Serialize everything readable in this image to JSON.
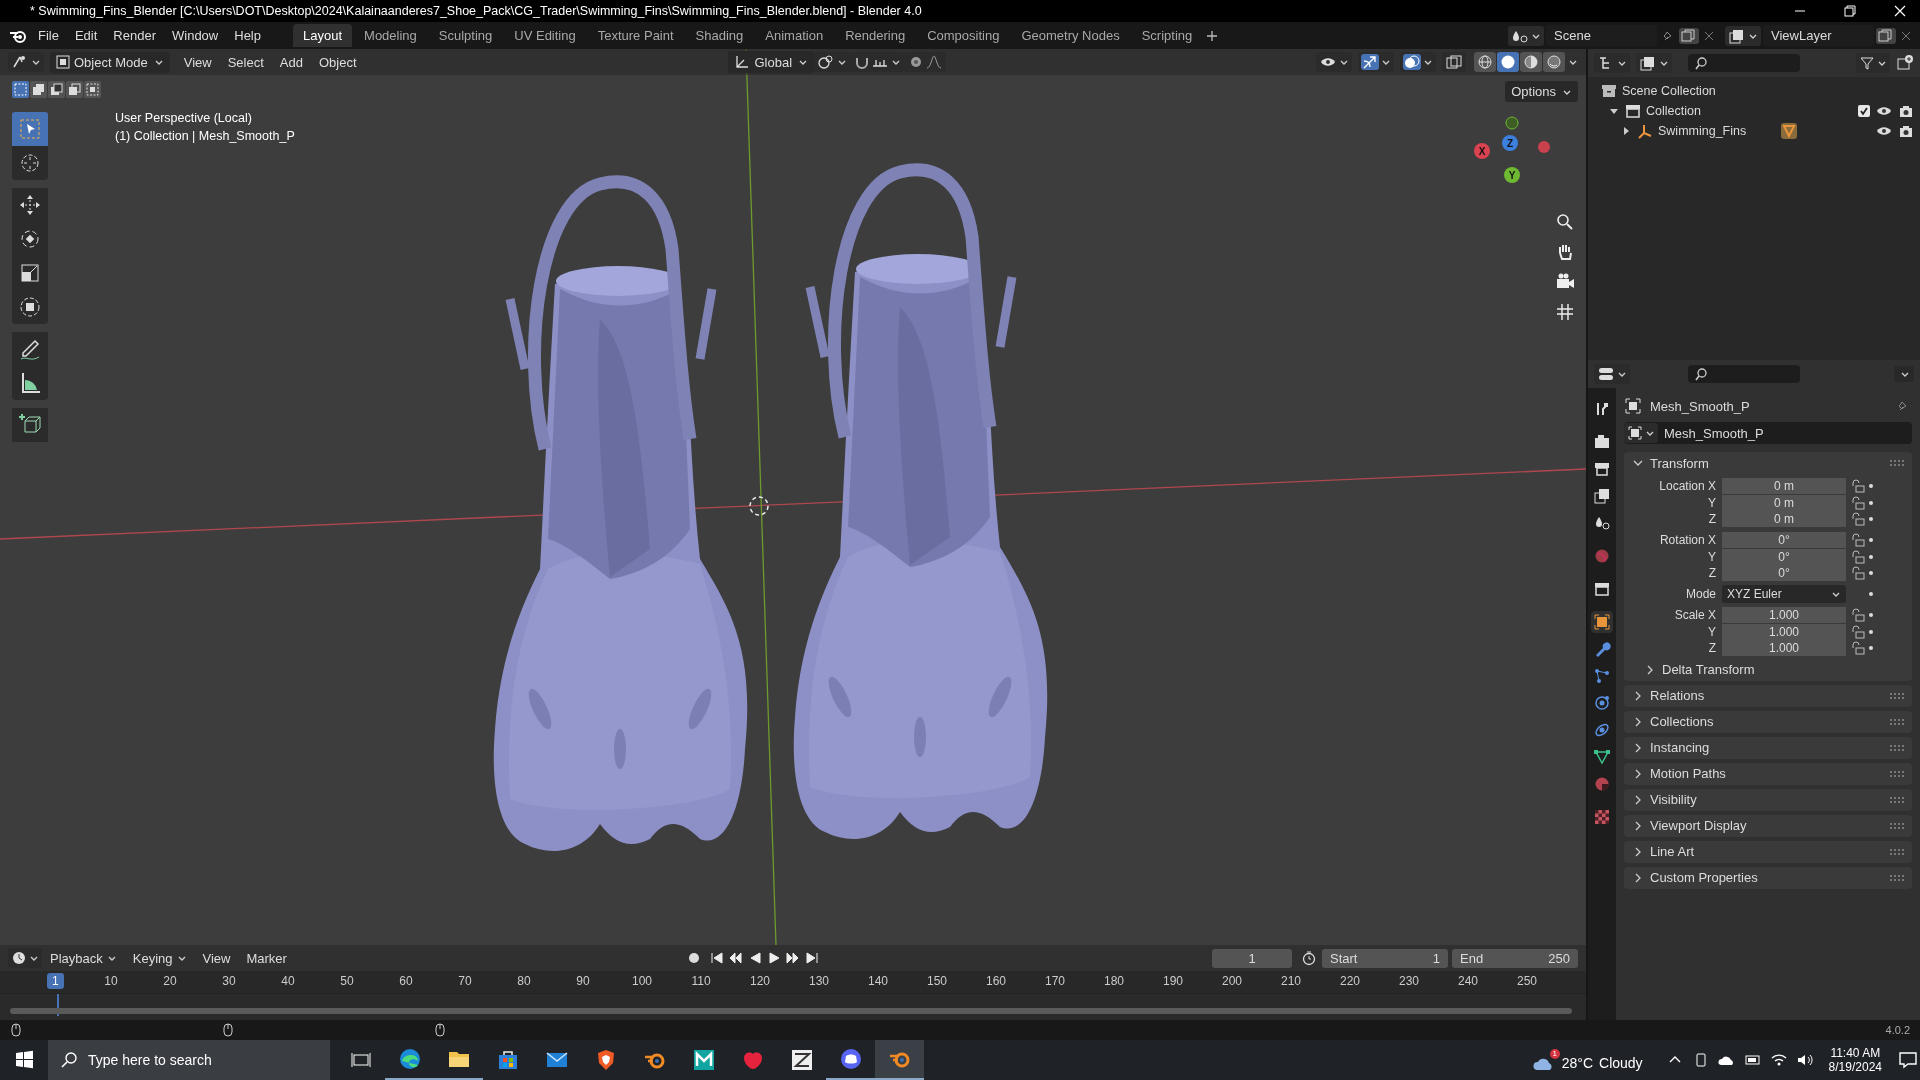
{
  "window": {
    "title": "* Swimming_Fins_Blender [C:\\Users\\DOT\\Desktop\\2024\\Kalainaanderes7_Shoe_Pack\\CG_Trader\\Swimming_Fins\\Swimming_Fins_Blender.blend] - Blender 4.0"
  },
  "menu": [
    "File",
    "Edit",
    "Render",
    "Window",
    "Help"
  ],
  "workspaces": [
    {
      "label": "Layout",
      "selected": true
    },
    {
      "label": "Modeling",
      "selected": false
    },
    {
      "label": "Sculpting",
      "selected": false
    },
    {
      "label": "UV Editing",
      "selected": false
    },
    {
      "label": "Texture Paint",
      "selected": false
    },
    {
      "label": "Shading",
      "selected": false
    },
    {
      "label": "Animation",
      "selected": false
    },
    {
      "label": "Rendering",
      "selected": false
    },
    {
      "label": "Compositing",
      "selected": false
    },
    {
      "label": "Geometry Nodes",
      "selected": false
    },
    {
      "label": "Scripting",
      "selected": false
    }
  ],
  "scene": {
    "value": "Scene"
  },
  "view_layer": {
    "value": "ViewLayer"
  },
  "viewport_header": {
    "mode": "Object Mode",
    "menus": [
      "View",
      "Select",
      "Add",
      "Object"
    ],
    "orientation": "Global",
    "toggles": [
      {
        "kind": "visibility",
        "on": false
      },
      {
        "kind": "gizmo",
        "on": true
      },
      {
        "kind": "overlay",
        "on": true
      },
      {
        "kind": "xray",
        "on": false
      }
    ],
    "shading": [
      {
        "kind": "wireframe",
        "selected": false
      },
      {
        "kind": "solid",
        "selected": true
      },
      {
        "kind": "material",
        "selected": false
      },
      {
        "kind": "rendered",
        "selected": false
      }
    ],
    "options": "Options"
  },
  "select_modes": [
    {
      "kind": "set",
      "selected": true
    },
    {
      "kind": "extend",
      "selected": false
    },
    {
      "kind": "subtract",
      "selected": false
    },
    {
      "kind": "difference",
      "selected": false
    },
    {
      "kind": "intersect",
      "selected": false
    }
  ],
  "tools": [
    {
      "kind": "select",
      "selected": true
    },
    {
      "kind": "cursor",
      "selected": false
    },
    {
      "kind": "move",
      "selected": false
    },
    {
      "kind": "rotate",
      "selected": false
    },
    {
      "kind": "scale",
      "selected": false
    },
    {
      "kind": "transform",
      "selected": false
    },
    {
      "kind": "annotate",
      "selected": false
    },
    {
      "kind": "measure",
      "selected": false
    },
    {
      "kind": "add_cube",
      "selected": false
    }
  ],
  "viewport": {
    "overlay": [
      "User Perspective (Local)",
      "(1) Collection | Mesh_Smooth_P"
    ],
    "gizmo": [
      {
        "label": "X",
        "color": "#d9424f"
      },
      {
        "label": "Z",
        "color": "#3d7fdc"
      },
      {
        "label": "Y",
        "color": "#6fb831"
      }
    ]
  },
  "outliner": {
    "items": [
      {
        "label": "Scene Collection",
        "kind": "scene_collection",
        "children": [
          {
            "label": "Collection",
            "kind": "collection",
            "expanded": true,
            "checked": true,
            "children": [
              {
                "label": "Swimming_Fins",
                "kind": "object",
                "expanded": false
              }
            ]
          }
        ]
      }
    ]
  },
  "properties": {
    "tabs": [
      {
        "kind": "tool",
        "selected": false
      },
      {
        "kind": "render",
        "selected": false
      },
      {
        "kind": "output",
        "selected": false
      },
      {
        "kind": "view_layer",
        "selected": false
      },
      {
        "kind": "scene",
        "selected": false
      },
      {
        "kind": "world",
        "selected": false
      },
      {
        "kind": "collection",
        "selected": false
      },
      {
        "kind": "object",
        "selected": true
      },
      {
        "kind": "modifier",
        "selected": false
      },
      {
        "kind": "particles",
        "selected": false
      },
      {
        "kind": "physics",
        "selected": false
      },
      {
        "kind": "constraints",
        "selected": false
      },
      {
        "kind": "data",
        "selected": false
      },
      {
        "kind": "material",
        "selected": false
      },
      {
        "kind": "texture",
        "selected": false
      }
    ],
    "object_name": "Mesh_Smooth_P",
    "datablock": "Mesh_Smooth_P",
    "transform": {
      "title": "Transform",
      "expanded": true,
      "groups": [
        [
          {
            "kind": "number",
            "label": "Location X",
            "value": "0 m"
          },
          {
            "kind": "number",
            "label": "Y",
            "value": "0 m"
          },
          {
            "kind": "number",
            "label": "Z",
            "value": "0 m"
          }
        ],
        [
          {
            "kind": "number",
            "label": "Rotation X",
            "value": "0°"
          },
          {
            "kind": "number",
            "label": "Y",
            "value": "0°"
          },
          {
            "kind": "number",
            "label": "Z",
            "value": "0°"
          }
        ],
        [
          {
            "kind": "dropdown",
            "label": "Mode",
            "value": "XYZ Euler"
          }
        ],
        [
          {
            "kind": "number",
            "label": "Scale X",
            "value": "1.000"
          },
          {
            "kind": "number",
            "label": "Y",
            "value": "1.000"
          },
          {
            "kind": "number",
            "label": "Z",
            "value": "1.000"
          }
        ]
      ],
      "subpanel": {
        "title": "Delta Transform",
        "expanded": false
      }
    },
    "panels": [
      {
        "title": "Relations",
        "expanded": false
      },
      {
        "title": "Collections",
        "expanded": false
      },
      {
        "title": "Instancing",
        "expanded": false
      },
      {
        "title": "Motion Paths",
        "expanded": false
      },
      {
        "title": "Visibility",
        "expanded": false
      },
      {
        "title": "Viewport Display",
        "expanded": false
      },
      {
        "title": "Line Art",
        "expanded": false
      },
      {
        "title": "Custom Properties",
        "expanded": false
      }
    ]
  },
  "timeline": {
    "menus": [
      "Playback",
      "Keying",
      "View",
      "Marker"
    ],
    "current_frame": "1",
    "start": {
      "label": "Start",
      "value": "1"
    },
    "end": {
      "label": "End",
      "value": "250"
    },
    "playhead": "1",
    "ticks": [
      "10",
      "20",
      "30",
      "40",
      "50",
      "60",
      "70",
      "80",
      "90",
      "100",
      "110",
      "120",
      "130",
      "140",
      "150",
      "160",
      "170",
      "180",
      "190",
      "200",
      "210",
      "220",
      "230",
      "240",
      "250"
    ]
  },
  "status_bar": {
    "version": "4.0.2"
  },
  "taskbar": {
    "search": {
      "placeholder": "Type here to search"
    },
    "apps": [
      {
        "kind": "task_view",
        "running": false,
        "selected": false
      },
      {
        "kind": "browser",
        "running": true,
        "selected": false
      },
      {
        "kind": "folder",
        "running": true,
        "selected": false
      },
      {
        "kind": "store",
        "running": false,
        "selected": false
      },
      {
        "kind": "mail",
        "running": false,
        "selected": false
      },
      {
        "kind": "shield",
        "running": false,
        "selected": false
      },
      {
        "kind": "ring",
        "running": false,
        "selected": false
      },
      {
        "kind": "tile_m",
        "running": false,
        "selected": false
      },
      {
        "kind": "blob",
        "running": false,
        "selected": false
      },
      {
        "kind": "tile_z",
        "running": false,
        "selected": false
      },
      {
        "kind": "chat",
        "running": true,
        "selected": false
      },
      {
        "kind": "ring",
        "running": true,
        "selected": true
      }
    ],
    "weather": {
      "badge": "1",
      "temperature": "28°C",
      "condition": "Cloudy"
    },
    "time": "11:40 AM",
    "date": "8/19/2024"
  }
}
